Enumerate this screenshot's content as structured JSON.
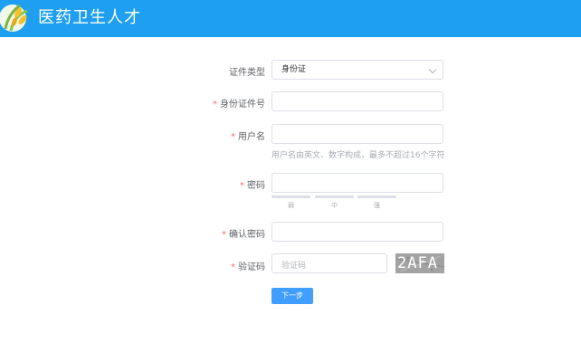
{
  "header": {
    "title": "医药卫生人才",
    "background_color": "#1e9ff2",
    "logo_icon": "wheat-leaf-logo-icon"
  },
  "form": {
    "required_marker": "*",
    "id_type": {
      "label": "证件类型",
      "value": "身份证",
      "icon": "chevron-down-icon"
    },
    "id_number": {
      "label": "身份证件号",
      "value": "",
      "placeholder": ""
    },
    "username": {
      "label": "用户名",
      "value": "",
      "placeholder": "",
      "hint": "用户名由英文、数字构成，最多不超过16个字符"
    },
    "password": {
      "label": "密码",
      "value": "",
      "placeholder": "",
      "strength_levels": [
        "弱",
        "中",
        "强"
      ]
    },
    "confirm_password": {
      "label": "确认密码",
      "value": "",
      "placeholder": ""
    },
    "captcha": {
      "label": "验证码",
      "value": "",
      "placeholder": "验证码",
      "image_text": "2AFA"
    },
    "next_button": {
      "label": "下一步",
      "color": "#409eff"
    }
  },
  "colors": {
    "required": "#f56c6c",
    "border": "#dcdfe6"
  }
}
